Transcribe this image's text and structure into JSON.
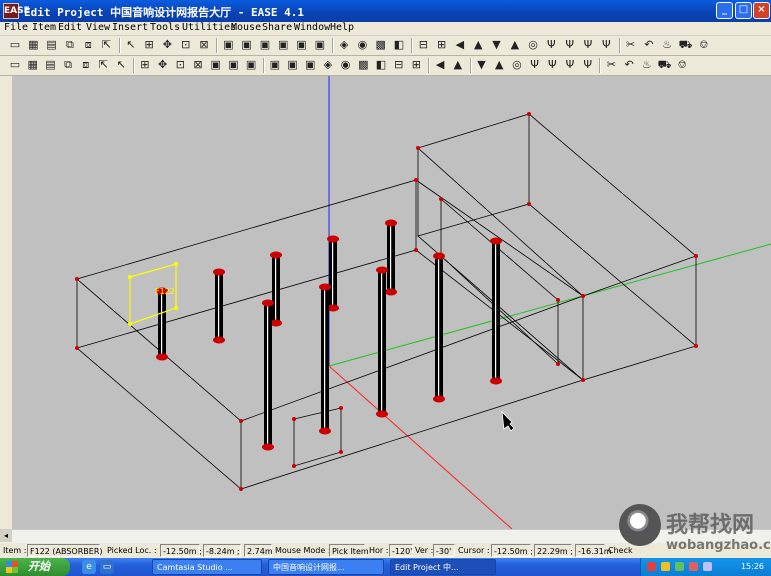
{
  "window": {
    "icon_label": "EASE",
    "title": "Edit Project  中国音响设计网报告大厅 - EASE 4.1",
    "minimize_label": "_",
    "maximize_label": "□",
    "close_label": "×"
  },
  "menu": {
    "items": [
      "File",
      "Item",
      "Edit",
      "View",
      "Insert",
      "Tools",
      "Utilities",
      "Mouse",
      "Share",
      "Window",
      "Help"
    ]
  },
  "toolbar1": {
    "icons": [
      "new-icon",
      "grid-icon",
      "save-icon",
      "copy-view-icon",
      "paste-view-icon",
      "export-icon",
      "pointer-icon",
      "zoom-box-icon",
      "pan-icon",
      "zoom-fit-icon",
      "zoom-extents-icon",
      "view1-icon",
      "view2-icon",
      "view3-icon",
      "view4-icon",
      "view5-icon",
      "view6-icon",
      "render-icon",
      "camera-icon",
      "color-icon",
      "palette-icon",
      "calc-icon",
      "table-icon",
      "arrow-left-icon",
      "up-icon",
      "down-icon",
      "up2-icon",
      "lamp-icon",
      "speaker-icon",
      "speaker2-icon",
      "speaker3-icon",
      "speaker4-icon",
      "cut-icon",
      "undo-icon",
      "bulb-icon",
      "car-icon",
      "probe-icon"
    ]
  },
  "toolbar2": {
    "icons": [
      "delete-icon",
      "line-icon",
      "joint-icon",
      "edge-icon",
      "measure-icon",
      "light-icon",
      "scale-icon",
      "delete2-icon",
      "line2-icon",
      "joint2-icon",
      "edge2-icon",
      "measure2-icon",
      "light2-icon",
      "scale2-icon",
      "face-icon",
      "face2-icon",
      "wedge-icon",
      "plane-icon",
      "plane2-icon",
      "light3-icon",
      "scale3-icon",
      "box-icon",
      "box2-icon",
      "undo-icon",
      "redo-icon",
      "delete3-icon",
      "line3-icon",
      "joint3-icon",
      "edge3-icon",
      "measure3-icon",
      "light4-icon",
      "scale4-icon",
      "box3-icon",
      "box4-icon",
      "box5-icon",
      "box6-icon",
      "calc2-icon"
    ]
  },
  "viewport": {
    "selected_label": "F122"
  },
  "status": {
    "item_label": "Item :",
    "item_value": "F122 (ABSORBER)",
    "picked_label": "Picked Loc. :",
    "picked_x": "-12.50m ;",
    "picked_y": "-8.24m ;",
    "picked_z": "2.74m",
    "mouse_mode_label": "Mouse Mode :",
    "mouse_mode_value": "Pick Item",
    "hor_label": "Hor :",
    "hor_value": "-120'",
    "ver_label": "Ver :",
    "ver_value": "-30'",
    "cursor_label": "Cursor :",
    "cursor_x": "-12.50m ;",
    "cursor_y": "22.29m ;",
    "cursor_z": "-16.31m",
    "check_label": "Check"
  },
  "taskbar": {
    "start_label": "开始",
    "tasks": [
      "Camtasia Studio ...",
      "中国音响设计网报...",
      "Edit Project 中..."
    ],
    "clock": "15:26"
  },
  "watermark": {
    "cn": "我帮找网",
    "url": "wobangzhao.com"
  },
  "colors": {
    "viewport_bg": "#c0c0c0",
    "axis_z": "#2020ff",
    "axis_x": "#ff2020",
    "axis_y": "#20c020",
    "selection": "#ffff00",
    "column": "#000000",
    "vertex": "#cc0000"
  }
}
